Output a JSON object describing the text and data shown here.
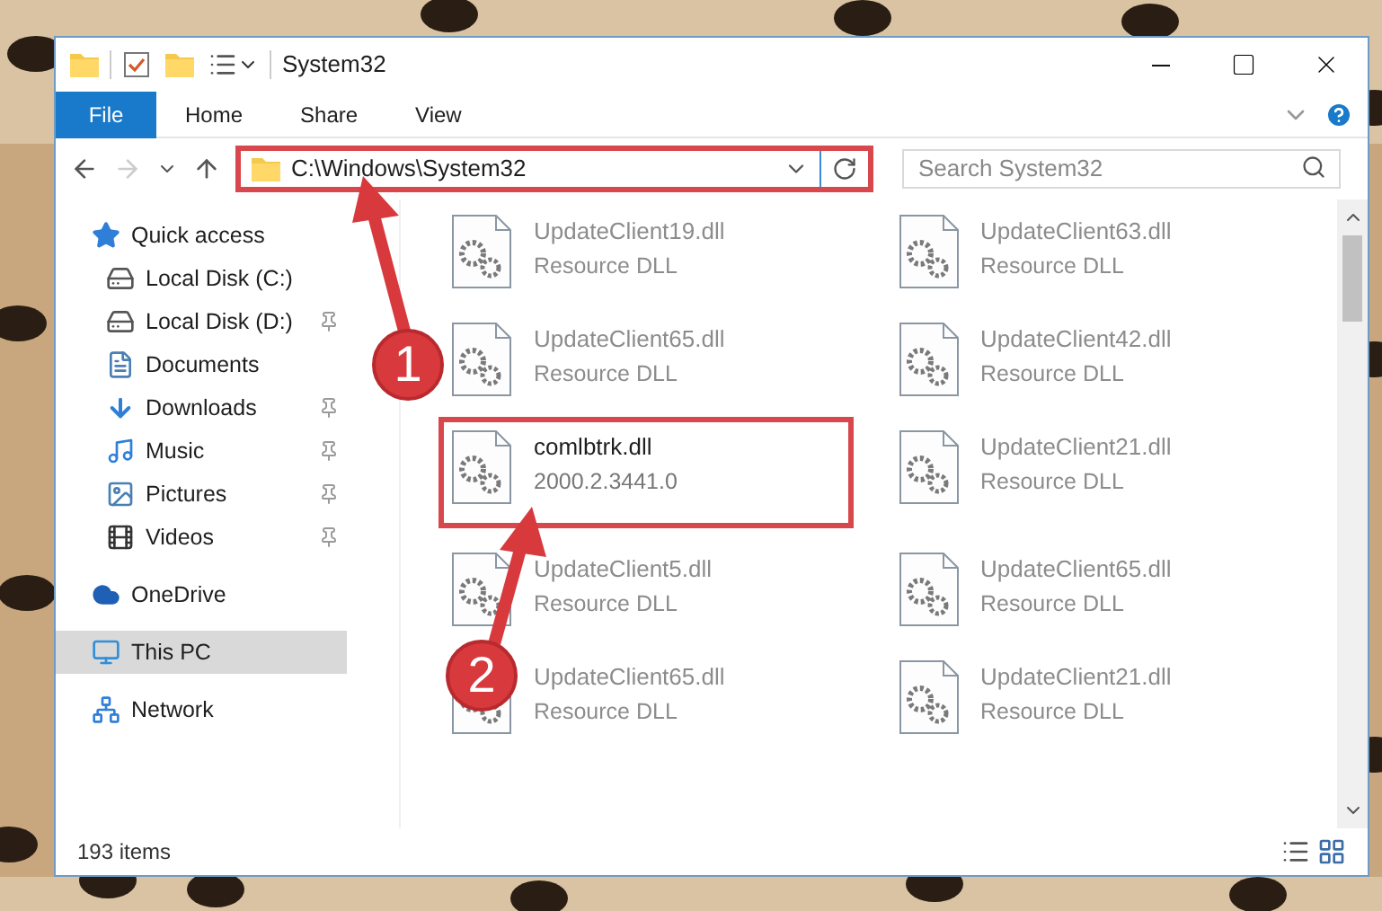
{
  "window": {
    "title": "System32"
  },
  "ribbon": {
    "tabs": [
      {
        "label": "File",
        "kind": "file"
      },
      {
        "label": "Home",
        "kind": "tab"
      },
      {
        "label": "Share",
        "kind": "tab"
      },
      {
        "label": "View",
        "kind": "tab"
      }
    ]
  },
  "address": {
    "path": "C:\\Windows\\System32",
    "highlighted": true
  },
  "search": {
    "placeholder": "Search System32"
  },
  "sidebar": {
    "items": [
      {
        "label": "Quick access",
        "kind": "star",
        "selected": false,
        "children": [
          {
            "label": "Local Disk (C:)",
            "kind": "drive-c",
            "pinned": false
          },
          {
            "label": "Local Disk (D:)",
            "kind": "drive",
            "pinned": true
          },
          {
            "label": "Documents",
            "kind": "documents",
            "pinned": false
          },
          {
            "label": "Downloads",
            "kind": "downloads",
            "pinned": true
          },
          {
            "label": "Music",
            "kind": "music",
            "pinned": true
          },
          {
            "label": "Pictures",
            "kind": "pictures",
            "pinned": true
          },
          {
            "label": "Videos",
            "kind": "videos",
            "pinned": true
          }
        ]
      },
      {
        "label": "OneDrive",
        "kind": "cloud",
        "selected": false
      },
      {
        "label": "This PC",
        "kind": "pc",
        "selected": true
      },
      {
        "label": "Network",
        "kind": "network",
        "selected": false
      }
    ]
  },
  "files": [
    {
      "name": "UpdateClient19.dll",
      "detail": "Resource DLL",
      "dimmed": true
    },
    {
      "name": "UpdateClient63.dll",
      "detail": "Resource DLL",
      "dimmed": true
    },
    {
      "name": "UpdateClient65.dll",
      "detail": "Resource DLL",
      "dimmed": true
    },
    {
      "name": "UpdateClient42.dll",
      "detail": "Resource DLL",
      "dimmed": true
    },
    {
      "name": "comlbtrk.dll",
      "detail": "2000.2.3441.0",
      "dimmed": false
    },
    {
      "name": "UpdateClient21.dll",
      "detail": "Resource DLL",
      "dimmed": true
    },
    {
      "name": "UpdateClient5.dll",
      "detail": "Resource DLL",
      "dimmed": true
    },
    {
      "name": "UpdateClient65.dll",
      "detail": "Resource DLL",
      "dimmed": true
    },
    {
      "name": "UpdateClient65.dll",
      "detail": "Resource DLL",
      "dimmed": true
    },
    {
      "name": "UpdateClient21.dll",
      "detail": "Resource DLL",
      "dimmed": true
    }
  ],
  "status_bar": {
    "count": "193 items"
  },
  "callouts": [
    {
      "label": "1"
    },
    {
      "label": "2"
    }
  ]
}
